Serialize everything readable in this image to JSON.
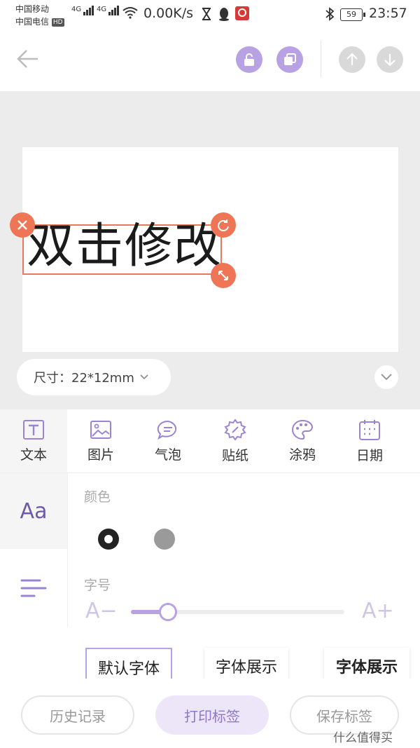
{
  "status_bar": {
    "carrier1": "中国移动",
    "carrier2": "中国电信",
    "hd": "HD",
    "net1": "4G",
    "net2": "4G",
    "speed": "0.00K/s",
    "battery": "59",
    "time": "23:57"
  },
  "toolbar": {
    "icons": [
      "back-arrow-icon",
      "unlock-icon",
      "copy-icon",
      "layer-up-icon",
      "layer-down-icon"
    ]
  },
  "canvas": {
    "text": "双击修改",
    "size_label": "尺寸：22*12mm",
    "colors": {
      "selection": "#e9775c",
      "handle": "#ef7557"
    }
  },
  "tabs": [
    {
      "label": "文本",
      "icon": "text-icon",
      "active": true
    },
    {
      "label": "图片",
      "icon": "image-icon",
      "active": false
    },
    {
      "label": "气泡",
      "icon": "bubble-icon",
      "active": false
    },
    {
      "label": "贴纸",
      "icon": "sticker-icon",
      "active": false
    },
    {
      "label": "涂鸦",
      "icon": "palette-icon",
      "active": false
    },
    {
      "label": "日期",
      "icon": "calendar-icon",
      "active": false
    }
  ],
  "side_panel": {
    "font_icon_text": "Aa"
  },
  "text_panel": {
    "color_label": "颜色",
    "swatches": [
      "#222222",
      "#9a9a9a"
    ],
    "size_label": "字号",
    "size_minus": "A−",
    "size_plus": "A+",
    "size_value_fraction": 0.17,
    "fonts": [
      "默认字体",
      "字体展示",
      "字体展示"
    ]
  },
  "bottom_bar": {
    "history": "历史记录",
    "print": "打印标签",
    "save": "保存标签"
  },
  "watermark": "什么值得买",
  "accent": "#b9a2e3"
}
